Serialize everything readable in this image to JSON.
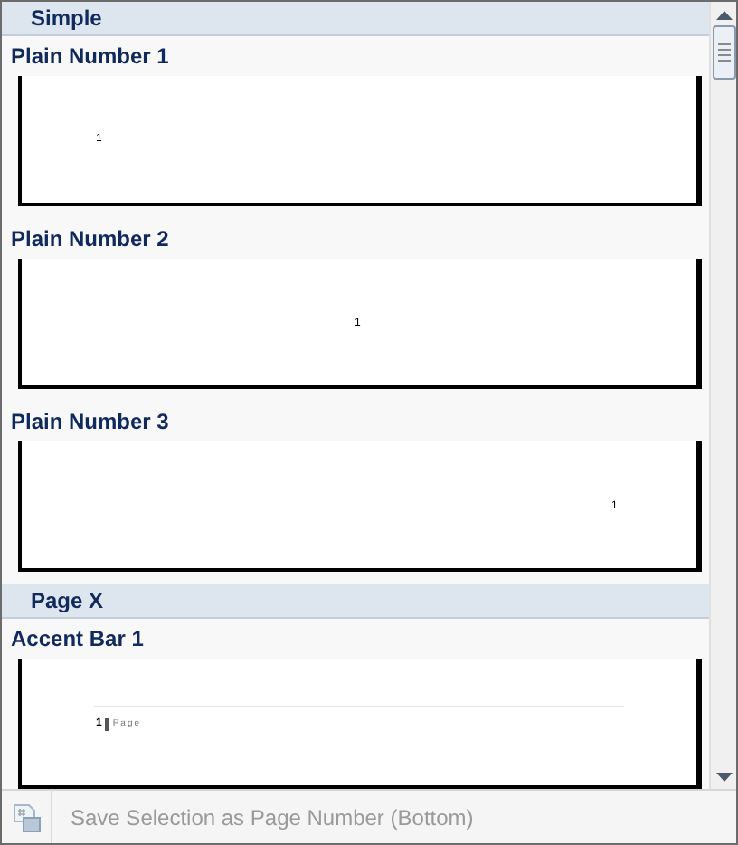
{
  "sections": [
    {
      "title": "Simple",
      "items": [
        {
          "title": "Plain Number 1",
          "kind": "left",
          "number": "1"
        },
        {
          "title": "Plain Number 2",
          "kind": "center",
          "number": "1"
        },
        {
          "title": "Plain Number 3",
          "kind": "right",
          "number": "1"
        }
      ]
    },
    {
      "title": "Page X",
      "items": [
        {
          "title": "Accent Bar 1",
          "kind": "accent",
          "number": "1",
          "word": "Page"
        }
      ]
    }
  ],
  "footer": {
    "label": "Save Selection as Page Number (Bottom)",
    "disabled": true
  }
}
